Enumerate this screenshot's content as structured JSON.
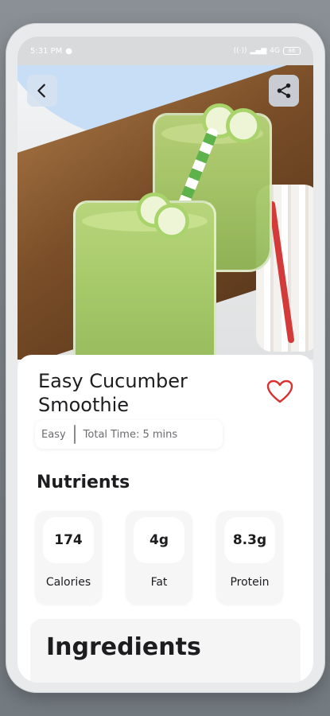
{
  "status_bar": {
    "time": "5:31 PM",
    "network": "4G",
    "battery": "86"
  },
  "header": {
    "back_icon": "chevron-left-icon",
    "share_icon": "share-icon"
  },
  "recipe": {
    "title": "Easy Cucumber Smoothie",
    "favorite_icon": "heart-outline-icon",
    "favorite_color": "#d93030",
    "difficulty": "Easy",
    "total_time": "Total Time: 5 mins"
  },
  "nutrients": {
    "heading": "Nutrients",
    "items": [
      {
        "value": "174",
        "label": "Calories"
      },
      {
        "value": "4g",
        "label": "Fat"
      },
      {
        "value": "8.3g",
        "label": "Protein"
      }
    ]
  },
  "ingredients": {
    "heading": "Ingredients"
  }
}
